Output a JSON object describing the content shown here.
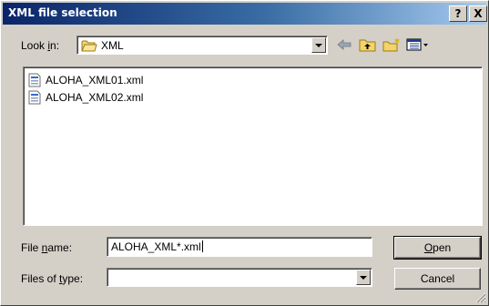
{
  "window": {
    "title": "XML file selection",
    "help_label": "?",
    "close_label": "X"
  },
  "lookin": {
    "label_prefix": "Look ",
    "label_accel": "i",
    "label_suffix": "n:",
    "folder": "XML",
    "folder_icon": "folder-icon"
  },
  "toolbar": {
    "icons": [
      "back-arrow-icon",
      "up-folder-icon",
      "new-folder-icon",
      "view-menu-icon"
    ]
  },
  "files": [
    {
      "name": "ALOHA_XML01.xml",
      "icon": "xml-file-icon"
    },
    {
      "name": "ALOHA_XML02.xml",
      "icon": "xml-file-icon"
    }
  ],
  "filename": {
    "label_prefix": "File ",
    "label_accel": "n",
    "label_suffix": "ame:",
    "value": "ALOHA_XML*.xml"
  },
  "filetype": {
    "label_prefix": "Files of ",
    "label_accel": "t",
    "label_suffix": "ype:",
    "value": ""
  },
  "buttons": {
    "open_accel": "O",
    "open_rest": "pen",
    "cancel": "Cancel"
  }
}
